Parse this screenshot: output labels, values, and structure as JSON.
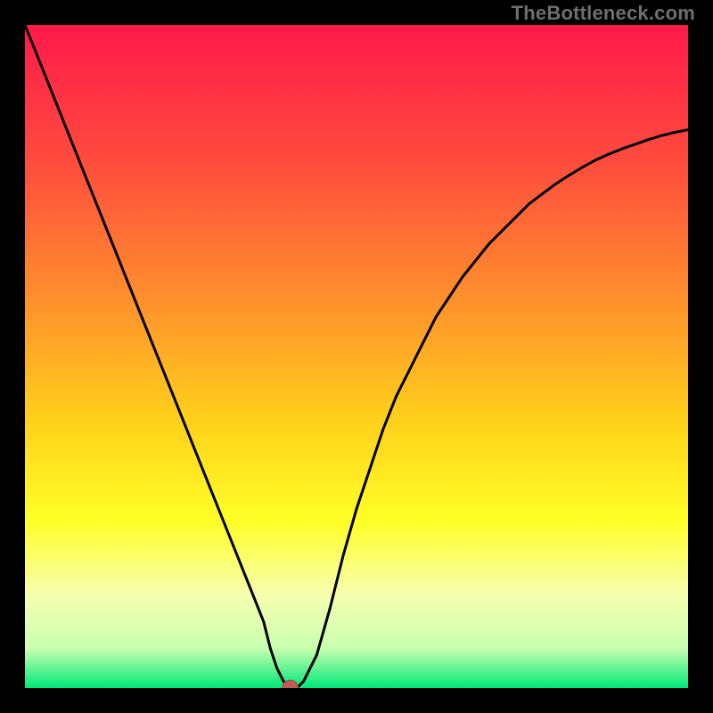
{
  "watermark": "TheBottleneck.com",
  "chart_data": {
    "type": "line",
    "title": "",
    "xlabel": "",
    "ylabel": "",
    "xlim": [
      0,
      100
    ],
    "ylim": [
      0,
      100
    ],
    "grid": false,
    "legend": false,
    "annotations": [],
    "gradient_stops": [
      {
        "offset": 0.0,
        "color": "#ff1a4b"
      },
      {
        "offset": 0.2,
        "color": "#ff4a3e"
      },
      {
        "offset": 0.4,
        "color": "#ff8b2e"
      },
      {
        "offset": 0.6,
        "color": "#ffd21a"
      },
      {
        "offset": 0.75,
        "color": "#ffff28"
      },
      {
        "offset": 0.86,
        "color": "#f7ffb0"
      },
      {
        "offset": 0.94,
        "color": "#c9ffb0"
      },
      {
        "offset": 1.0,
        "color": "#00e878"
      }
    ],
    "marker": {
      "x": 40,
      "y": 0,
      "color": "#c05a57",
      "radius": 1.2
    },
    "series": [
      {
        "name": "curve",
        "x": [
          0,
          2,
          4,
          6,
          8,
          10,
          12,
          14,
          16,
          18,
          20,
          22,
          24,
          26,
          28,
          30,
          32,
          34,
          36,
          37,
          38,
          39,
          40,
          41,
          42,
          44,
          46,
          48,
          50,
          52,
          54,
          56,
          58,
          60,
          62,
          64,
          66,
          68,
          70,
          72,
          74,
          76,
          78,
          80,
          82,
          84,
          86,
          88,
          90,
          92,
          94,
          96,
          98,
          100
        ],
        "y": [
          100,
          95,
          90,
          85,
          80,
          75,
          70,
          65,
          60,
          55,
          50,
          45,
          40,
          35,
          30,
          25,
          20,
          15,
          10,
          6,
          3,
          1,
          0,
          0,
          1,
          5,
          12,
          20,
          27,
          33,
          39,
          44,
          48,
          52,
          56,
          59,
          62,
          64.5,
          67,
          69,
          71,
          73,
          74.5,
          76,
          77.3,
          78.5,
          79.6,
          80.5,
          81.3,
          82,
          82.7,
          83.3,
          83.8,
          84.2
        ]
      }
    ]
  }
}
